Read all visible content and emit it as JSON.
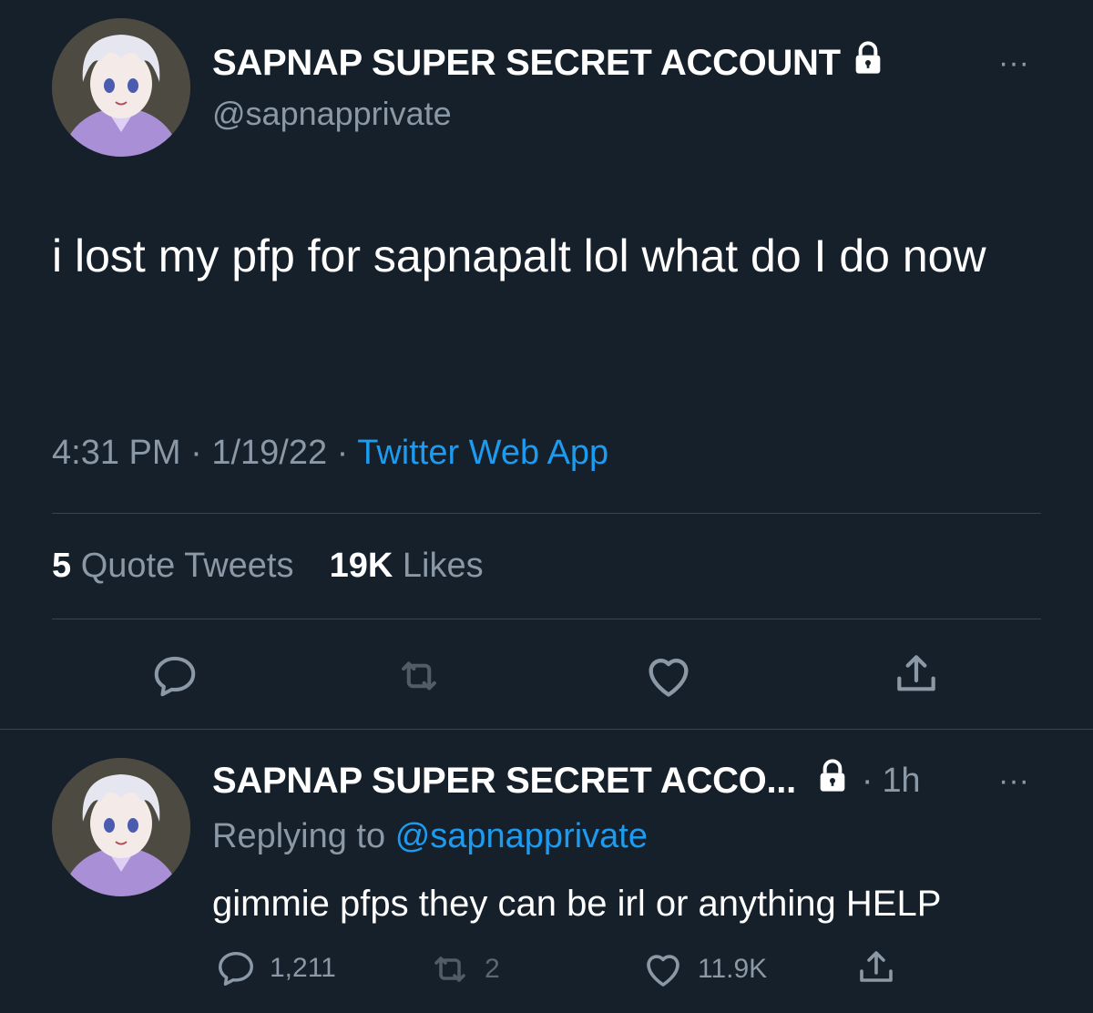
{
  "main_tweet": {
    "display_name": "SAPNAP SUPER SECRET ACCOUNT",
    "handle": "@sapnapprivate",
    "text": "i lost my pfp for sapnapalt lol what do I do now",
    "time": "4:31 PM",
    "date": "1/19/22",
    "source": "Twitter Web App",
    "separator": "·",
    "quote_count": "5",
    "quote_label": "Quote Tweets",
    "like_count": "19K",
    "like_label": "Likes",
    "more_icon": "···"
  },
  "reply": {
    "display_name": "SAPNAP SUPER SECRET ACCO...",
    "age": "1h",
    "separator": "·",
    "replying_prefix": "Replying to",
    "replying_to": "@sapnapprivate",
    "text": "gimmie pfps they can be  irl or anything HELP",
    "reply_count": "1,211",
    "retweet_count": "2",
    "like_count": "11.9K",
    "more_icon": "···"
  },
  "icons": {
    "lock": "lock-icon",
    "reply": "reply-icon",
    "retweet": "retweet-icon",
    "like": "heart-icon",
    "share": "share-icon"
  },
  "colors": {
    "background": "#15202b",
    "text": "#ffffff",
    "secondary": "#8b98a5",
    "link": "#1d9bf0",
    "divider": "#38444d"
  }
}
